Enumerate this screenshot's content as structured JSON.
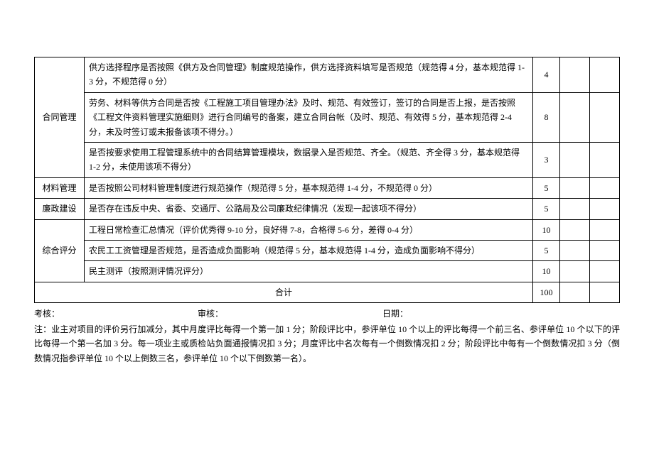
{
  "table": {
    "rows": [
      {
        "category": "合同管理",
        "rowspan": 3,
        "items": [
          {
            "desc": "供方选择程序是否按照《供方及合同管理》制度规范操作，供方选择资料填写是否规范（规范得 4 分，基本规范得 1-3 分，不规范得 0 分）",
            "score": "4"
          },
          {
            "desc": "劳务、材料等供方合同是否按《工程施工项目管理办法》及时、规范、有效签订，签订的合同是否上报，是否按照《工程文件资料管理实施细则》进行合同编号的备案，建立合同台帐（及时、规范、有效得 5 分，基本规范得 2-4 分，未及时签订或未报备该项不得分。）",
            "score": "8"
          },
          {
            "desc": "是否按要求使用工程管理系统中的合同结算管理模块，数据录入是否规范、齐全。（规范、齐全得 3 分，基本规范得 1-2 分，未使用该项不得分）",
            "score": "3"
          }
        ]
      },
      {
        "category": "材料管理",
        "rowspan": 1,
        "items": [
          {
            "desc": "是否按照公司材料管理制度进行规范操作（规范得 5 分，基本规范得 1-4 分，不规范得 0 分）",
            "score": "5"
          }
        ]
      },
      {
        "category": "廉政建设",
        "rowspan": 1,
        "items": [
          {
            "desc": "是否存在违反中央、省委、交通厅、公路局及公司廉政纪律情况（发现一起该项不得分）",
            "score": "5"
          }
        ]
      },
      {
        "category": "综合评分",
        "rowspan": 3,
        "items": [
          {
            "desc": "工程日常检查汇总情况（评价优秀得 9-10 分，良好得 7-8，合格得 5-6 分，差得 0-4 分）",
            "score": "10"
          },
          {
            "desc": "农民工工资管理是否规范，是否造成负面影响（规范得 5 分，基本规范得 1-4 分，造成负面影响不得分）",
            "score": "5"
          },
          {
            "desc": "民主测评（按照测评情况评分）",
            "score": "10"
          }
        ]
      }
    ],
    "total_label": "合计",
    "total_score": "100"
  },
  "footer": {
    "assess": "考核：",
    "review": "审核：",
    "date": "日期："
  },
  "note": "注：业主对项目的评价另行加减分，其中月度评比每得一个第一加 1 分；阶段评比中，参评单位 10 个以上的评比每得一个前三名、参评单位 10 个以下的评比每得一个第一名加 3 分。每一项业主或质检站负面通报情况扣 3 分；月度评比中名次每有一个倒数情况扣 2 分；阶段评比中每有一个倒数情况扣 3 分（倒数情况指参评单位 10 个以上倒数三名，参评单位 10 个以下倒数第一名）。"
}
